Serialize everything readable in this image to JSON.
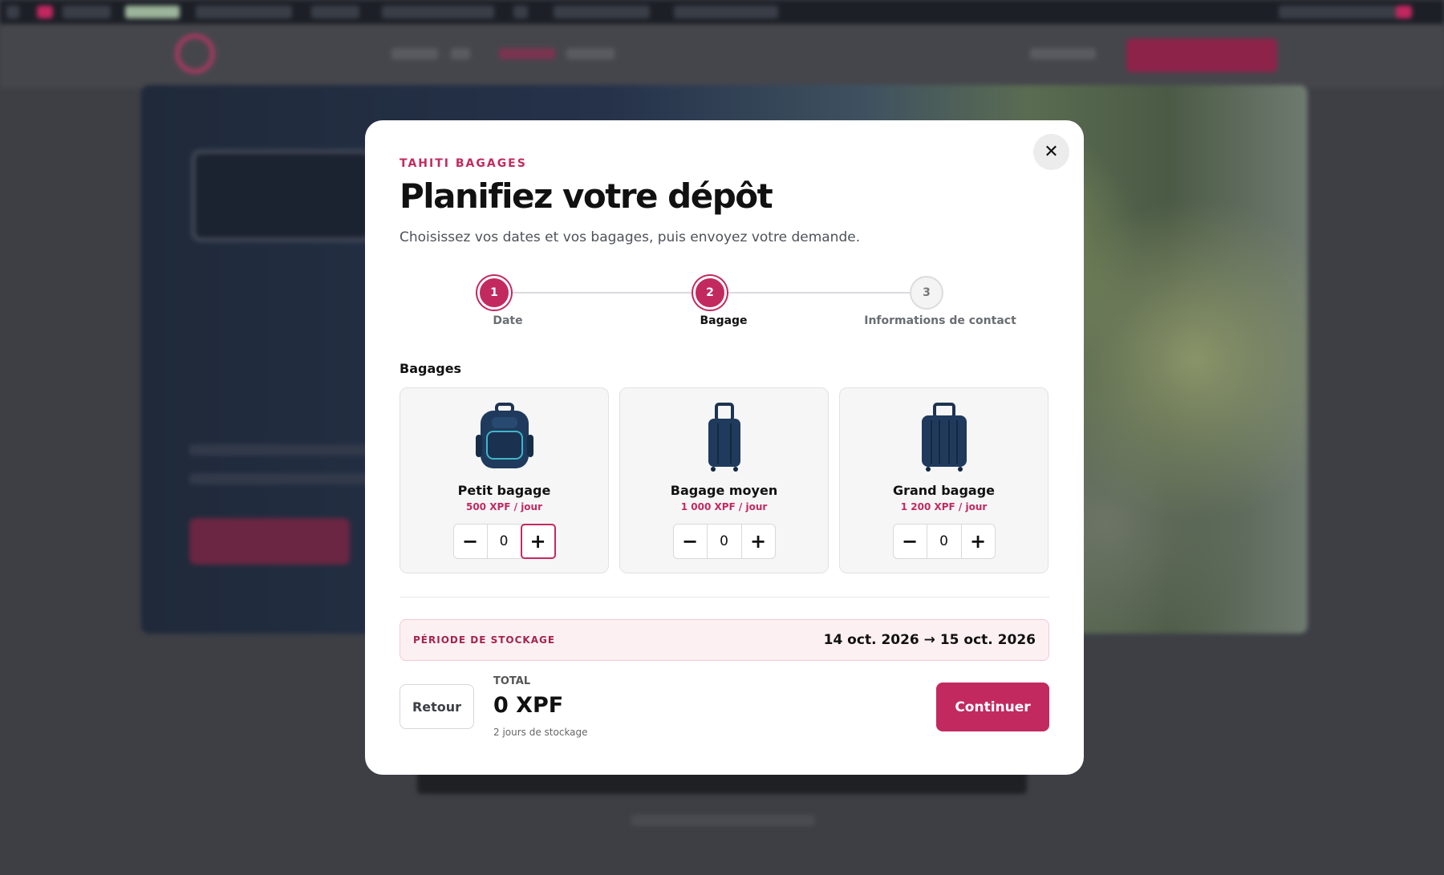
{
  "colors": {
    "accent": "#c22a5f",
    "accent_light": "#fdf0f3",
    "overlay": "#3d3f45"
  },
  "modal": {
    "eyebrow": "TAHITI BAGAGES",
    "title": "Planifiez votre dépôt",
    "subtitle": "Choisissez vos dates et vos bagages, puis envoyez votre demande.",
    "close_icon": "close-icon",
    "steps": [
      {
        "number": "1",
        "label": "Date",
        "state": "done"
      },
      {
        "number": "2",
        "label": "Bagage",
        "state": "current"
      },
      {
        "number": "3",
        "label": "Informations de contact",
        "state": "todo"
      }
    ],
    "section_label": "Bagages",
    "bags": [
      {
        "name": "Petit bagage",
        "price": "500 XPF / jour",
        "qty": "0",
        "icon": "backpack-icon"
      },
      {
        "name": "Bagage moyen",
        "price": "1 000 XPF / jour",
        "qty": "0",
        "icon": "suitcase-icon"
      },
      {
        "name": "Grand bagage",
        "price": "1 200 XPF / jour",
        "qty": "0",
        "icon": "large-suitcase-icon"
      }
    ],
    "period": {
      "label": "PÉRIODE DE STOCKAGE",
      "value": "14 oct. 2026 → 15 oct. 2026"
    },
    "back_label": "Retour",
    "total": {
      "label": "TOTAL",
      "value": "0 XPF",
      "note": "2 jours de stockage"
    },
    "continue_label": "Continuer"
  }
}
